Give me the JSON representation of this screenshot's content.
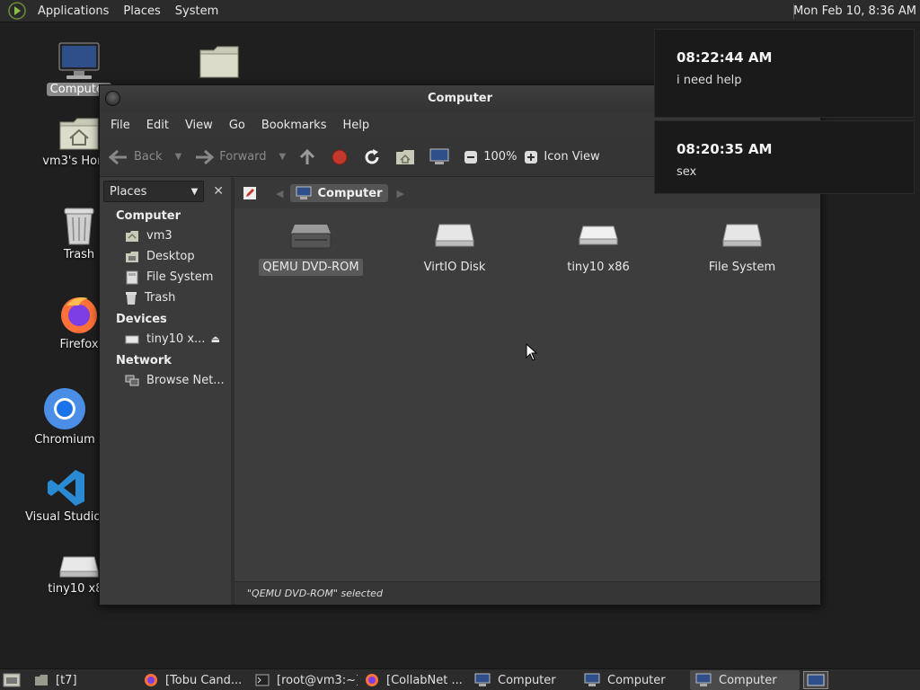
{
  "top_panel": {
    "menus": [
      "Applications",
      "Places",
      "System"
    ],
    "clock": "Mon Feb 10,  8:36 AM"
  },
  "desktop": {
    "icons": [
      {
        "label": "Computer"
      },
      {
        "label": ""
      },
      {
        "label": "vm3's Home"
      },
      {
        "label": "Trash"
      },
      {
        "label": "Firefox"
      },
      {
        "label": "Chromium"
      },
      {
        "label": "Visual Studio Code"
      },
      {
        "label": "tiny10 x86"
      }
    ]
  },
  "window": {
    "title": "Computer",
    "menu": [
      "File",
      "Edit",
      "View",
      "Go",
      "Bookmarks",
      "Help"
    ],
    "toolbar": {
      "back": "Back",
      "forward": "Forward",
      "zoom": "100%",
      "view_mode": "Icon View"
    },
    "sidebar": {
      "selector": "Places",
      "sections": [
        {
          "heading": "Computer",
          "items": [
            "vm3",
            "Desktop",
            "File System",
            "Trash"
          ]
        },
        {
          "heading": "Devices",
          "items": [
            "tiny10 x..."
          ]
        },
        {
          "heading": "Network",
          "items": [
            "Browse Net..."
          ]
        }
      ]
    },
    "path": {
      "crumb": "Computer"
    },
    "files": [
      {
        "label": "QEMU DVD-ROM",
        "icon": "optical-drive-icon",
        "selected": true
      },
      {
        "label": "VirtIO Disk",
        "icon": "hard-disk-icon",
        "selected": false
      },
      {
        "label": "tiny10 x86",
        "icon": "drive-icon",
        "selected": false
      },
      {
        "label": "File System",
        "icon": "hard-disk-icon",
        "selected": false
      }
    ],
    "status": "\"QEMU DVD-ROM\" selected"
  },
  "notifications": [
    {
      "time": "08:22:44 AM",
      "message": "i need help"
    },
    {
      "time": "08:20:35 AM",
      "message": "sex"
    }
  ],
  "taskbar": {
    "tasks": [
      {
        "label": "[t7]"
      },
      {
        "label": "[Tobu Cand..."
      },
      {
        "label": "[root@vm3:~]"
      },
      {
        "label": "[CollabNet ..."
      },
      {
        "label": "Computer"
      },
      {
        "label": "Computer"
      },
      {
        "label": "Computer"
      }
    ]
  }
}
